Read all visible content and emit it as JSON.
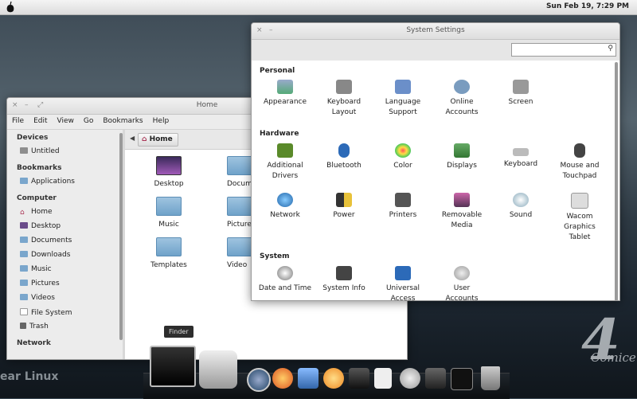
{
  "topbar": {
    "clock": "Sun Feb 19,  7:29 PM",
    "logo_icon": "pear-logo-icon"
  },
  "wallpaper": {
    "text": "ear Linux",
    "badge_number": "4",
    "badge_text": "Comice"
  },
  "file_manager": {
    "title": "Home",
    "menu": [
      "File",
      "Edit",
      "View",
      "Go",
      "Bookmarks",
      "Help"
    ],
    "sidebar": {
      "devices_heading": "Devices",
      "devices": [
        "Untitled"
      ],
      "bookmarks_heading": "Bookmarks",
      "bookmarks": [
        "Applications"
      ],
      "computer_heading": "Computer",
      "computer": [
        "Home",
        "Desktop",
        "Documents",
        "Downloads",
        "Music",
        "Pictures",
        "Videos",
        "File System",
        "Trash"
      ],
      "network_heading": "Network"
    },
    "path": "Home",
    "files": [
      "Desktop",
      "Docume",
      "Music",
      "Picture",
      "Templates",
      "Video"
    ]
  },
  "settings": {
    "title": "System Settings",
    "search_placeholder": "",
    "personal_heading": "Personal",
    "personal": [
      "Appearance",
      "Keyboard\nLayout",
      "Language\nSupport",
      "Online\nAccounts",
      "Screen"
    ],
    "hardware_heading": "Hardware",
    "hardware_row1": [
      "Additional\nDrivers",
      "Bluetooth",
      "Color",
      "Displays",
      "Keyboard",
      "Mouse and\nTouchpad"
    ],
    "hardware_row2": [
      "Network",
      "Power",
      "Printers",
      "Removable\nMedia",
      "Sound",
      "Wacom\nGraphics\nTablet"
    ],
    "system_heading": "System",
    "system": [
      "Date and Time",
      "System Info",
      "Universal\nAccess",
      "User\nAccounts"
    ]
  },
  "tooltip": "Finder",
  "dock": [
    "finder-icon",
    "launchpad-icon",
    "app-store-icon",
    "firefox-icon",
    "mail-icon",
    "photos-icon",
    "media-player-icon",
    "document-icon",
    "users-icon",
    "system-settings-icon",
    "terminal-icon",
    "trash-icon"
  ]
}
